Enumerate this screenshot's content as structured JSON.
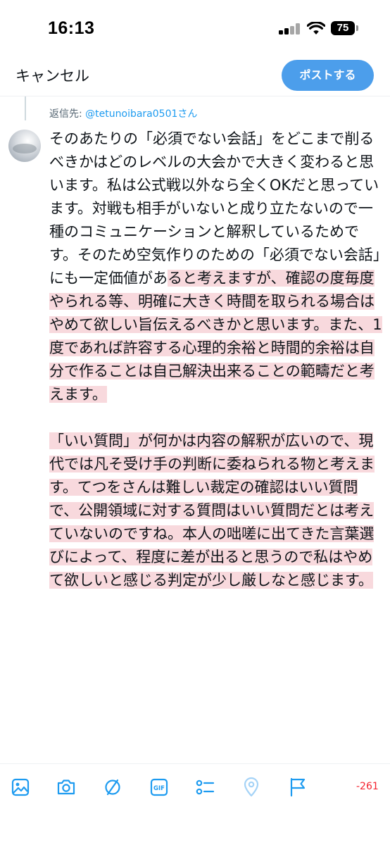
{
  "status_bar": {
    "time": "16:13",
    "battery": "75"
  },
  "header": {
    "cancel_label": "キャンセル",
    "post_label": "ポストする"
  },
  "reply": {
    "reply_to_prefix": "返信先: ",
    "reply_to_handle": "@tetunoibara0501",
    "reply_to_suffix": "さん",
    "text_within_limit": "そのあたりの「必須でない会話」をどこまで削るべきかはどのレベルの大会かで大きく変わると思います。私は公式戦以外なら全くOKだと思っています。対戦も相手がいないと成り立たないので一種のコミュニケーションと解釈しているためです。そのため空気作りのための「必須でない会話」にも一定価値があ",
    "text_over_limit": "ると考えますが、確認の度毎度やられる等、明確に大きく時間を取られる場合はやめて欲しい旨伝えるべきかと思います。また、1度であれば許容する心理的余裕と時間的余裕は自分で作ることは自己解決出来ることの範疇だと考えます。\n\n「いい質問」が何かは内容の解釈が広いので、現代では凡そ受け手の判断に委ねられる物と考えます。てつをさんは難しい裁定の確認はいい質問で、公開領域に対する質問はいい質問だとは考えていないのですね。本人の咄嗟に出てきた言葉選びによって、程度に差が出ると思うので私はやめて欲しいと感じる判定が少し厳しなと感じます。"
  },
  "toolbar": {
    "icons": [
      "image-icon",
      "camera-icon",
      "no-signal-icon",
      "gif-icon",
      "poll-icon",
      "location-icon",
      "flag-icon"
    ],
    "gif_label": "GIF",
    "char_count": "-261"
  },
  "colors": {
    "accent": "#1d9bf0",
    "post_button": "#4c9eeb",
    "over_limit_highlight": "#f8d9dd",
    "char_count": "#f4212e"
  }
}
